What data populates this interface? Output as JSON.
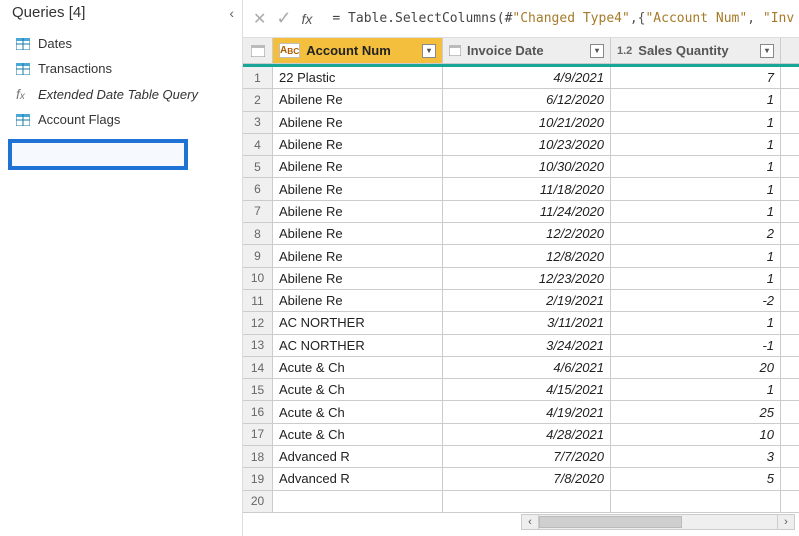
{
  "queries": {
    "header": "Queries [4]",
    "items": [
      {
        "label": "Dates",
        "icon": "table"
      },
      {
        "label": "Transactions",
        "icon": "table"
      },
      {
        "label": "Extended Date Table Query",
        "icon": "fx"
      },
      {
        "label": "Account Flags",
        "icon": "table",
        "highlighted": true
      }
    ]
  },
  "formula_bar": {
    "fx_label": "fx",
    "expr_prefix": "= Table.SelectColumns(#",
    "arg1": "\"Changed Type4\"",
    "mid": ",{",
    "col1": "\"Account Num\"",
    "sep": ", ",
    "col2": "\"Inv"
  },
  "columns": [
    {
      "type_prefix": "ABC",
      "label": "Account Num",
      "active": true
    },
    {
      "type_prefix": "",
      "label": "Invoice Date",
      "active": false
    },
    {
      "type_prefix": "1.2",
      "label": "Sales Quantity",
      "active": false
    }
  ],
  "rows": [
    {
      "n": 1,
      "acct": "22 Plastic",
      "date": "4/9/2021",
      "qty": "7"
    },
    {
      "n": 2,
      "acct": "Abilene Re",
      "date": "6/12/2020",
      "qty": "1"
    },
    {
      "n": 3,
      "acct": "Abilene Re",
      "date": "10/21/2020",
      "qty": "1"
    },
    {
      "n": 4,
      "acct": "Abilene Re",
      "date": "10/23/2020",
      "qty": "1"
    },
    {
      "n": 5,
      "acct": "Abilene Re",
      "date": "10/30/2020",
      "qty": "1"
    },
    {
      "n": 6,
      "acct": "Abilene Re",
      "date": "11/18/2020",
      "qty": "1"
    },
    {
      "n": 7,
      "acct": "Abilene Re",
      "date": "11/24/2020",
      "qty": "1"
    },
    {
      "n": 8,
      "acct": "Abilene Re",
      "date": "12/2/2020",
      "qty": "2"
    },
    {
      "n": 9,
      "acct": "Abilene Re",
      "date": "12/8/2020",
      "qty": "1"
    },
    {
      "n": 10,
      "acct": "Abilene Re",
      "date": "12/23/2020",
      "qty": "1"
    },
    {
      "n": 11,
      "acct": "Abilene Re",
      "date": "2/19/2021",
      "qty": "-2"
    },
    {
      "n": 12,
      "acct": "AC NORTHER",
      "date": "3/11/2021",
      "qty": "1"
    },
    {
      "n": 13,
      "acct": "AC NORTHER",
      "date": "3/24/2021",
      "qty": "-1"
    },
    {
      "n": 14,
      "acct": "Acute & Ch",
      "date": "4/6/2021",
      "qty": "20"
    },
    {
      "n": 15,
      "acct": "Acute & Ch",
      "date": "4/15/2021",
      "qty": "1"
    },
    {
      "n": 16,
      "acct": "Acute & Ch",
      "date": "4/19/2021",
      "qty": "25"
    },
    {
      "n": 17,
      "acct": "Acute & Ch",
      "date": "4/28/2021",
      "qty": "10"
    },
    {
      "n": 18,
      "acct": "Advanced R",
      "date": "7/7/2020",
      "qty": "3"
    },
    {
      "n": 19,
      "acct": "Advanced R",
      "date": "7/8/2020",
      "qty": "5"
    },
    {
      "n": 20,
      "acct": "",
      "date": "",
      "qty": ""
    }
  ]
}
